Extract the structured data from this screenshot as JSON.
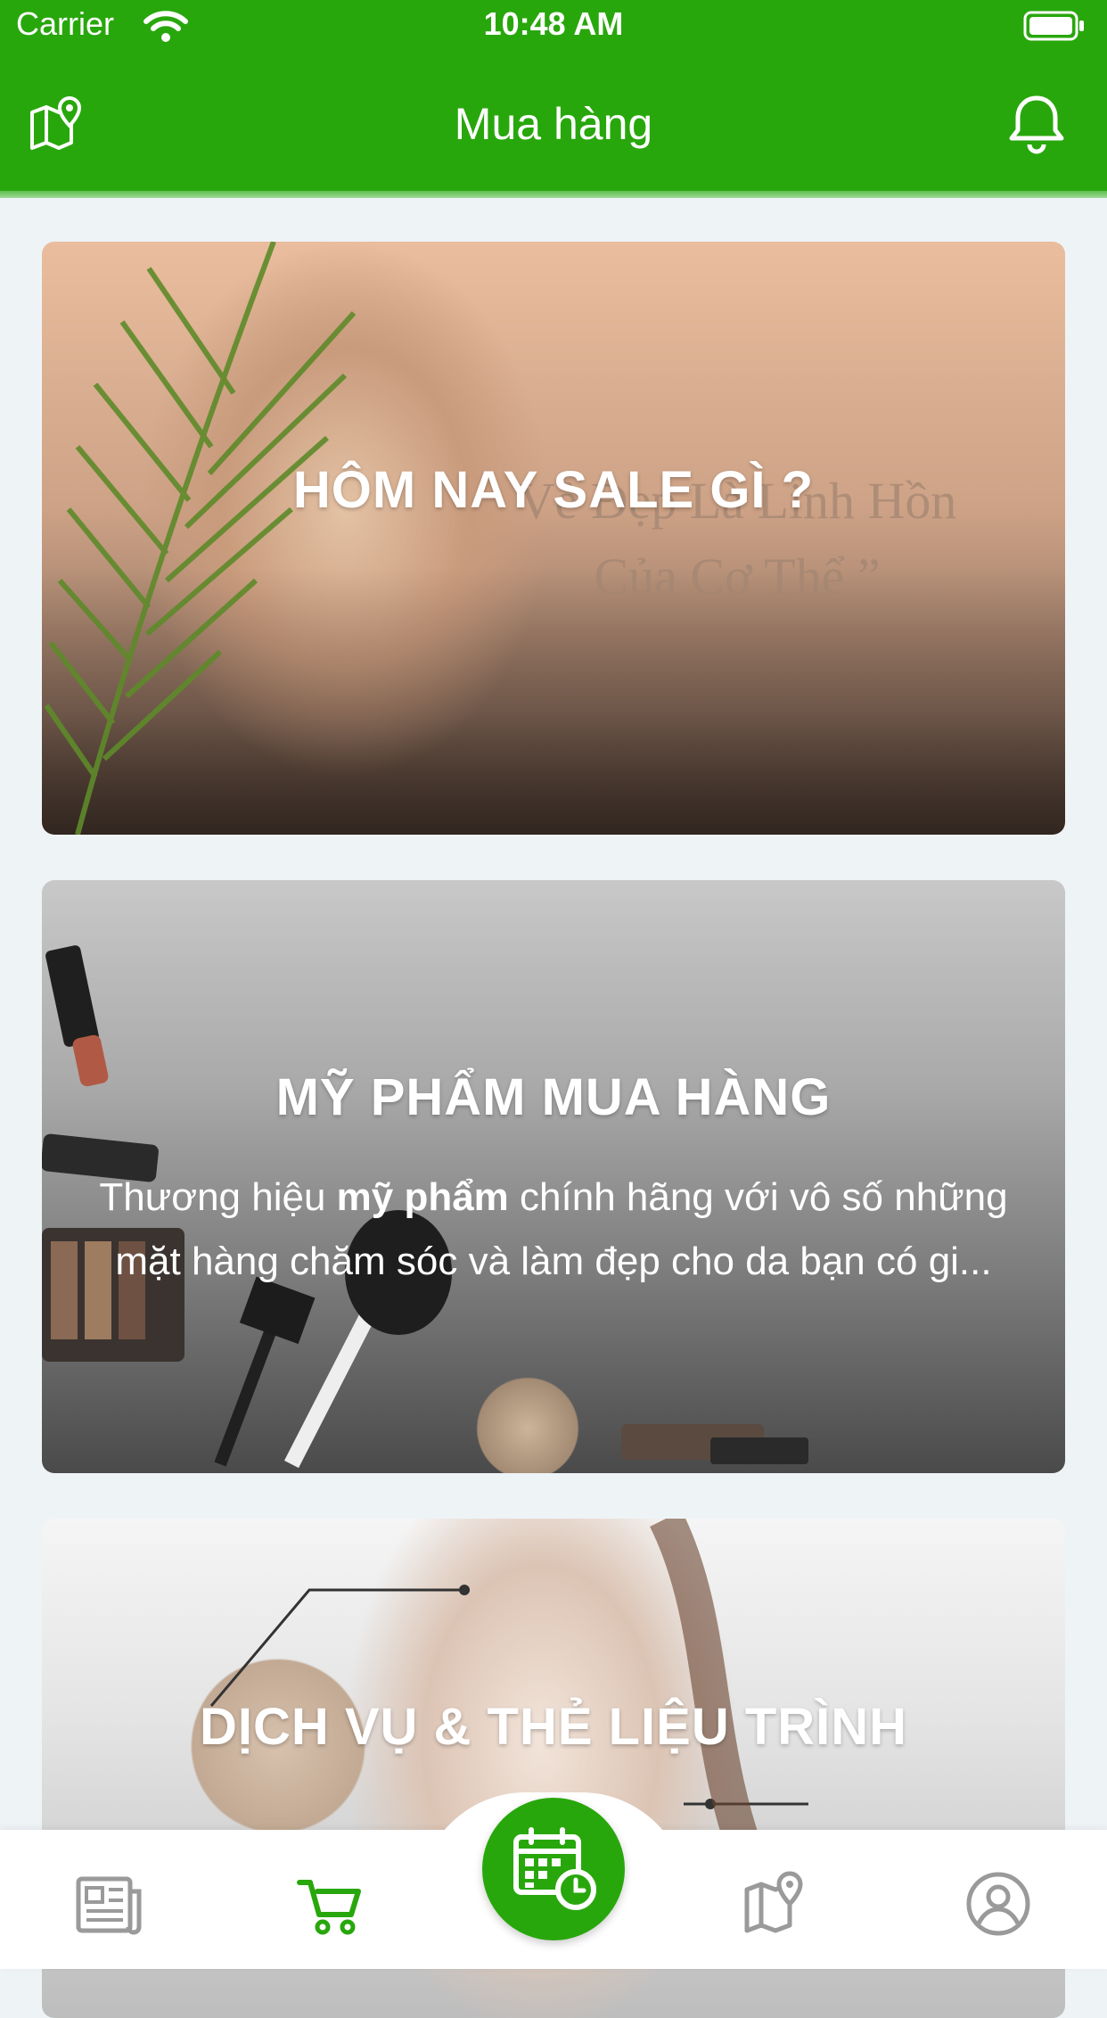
{
  "status_bar": {
    "carrier": "Carrier",
    "time": "10:48 AM"
  },
  "header": {
    "title": "Mua hàng",
    "left_icon": "map-pin-icon",
    "right_icon": "bell-icon"
  },
  "cards": [
    {
      "title": "HÔM NAY SALE GÌ ?",
      "image_text_line1": "Vẻ Đẹp Là Linh Hồn",
      "image_text_line2": "Của Cơ Thể ”"
    },
    {
      "title": "MỸ PHẨM MUA HÀNG",
      "desc_prefix": "Thương hiệu ",
      "desc_bold": "mỹ phẩm",
      "desc_suffix": " chính hãng với vô số những mặt hàng chăm sóc và làm đẹp cho da bạn có gi..."
    },
    {
      "title": "DỊCH VỤ & THẺ LIỆU TRÌNH"
    }
  ],
  "bottom_nav": {
    "items": [
      {
        "icon": "news-icon"
      },
      {
        "icon": "cart-icon",
        "active": true
      },
      {
        "icon": "calendar-clock-icon"
      },
      {
        "icon": "map-pin-icon"
      },
      {
        "icon": "user-icon"
      }
    ],
    "active_color": "#28a70c",
    "inactive_color": "#9a9a9a"
  },
  "colors": {
    "brand": "#28a70c",
    "background": "#eef3f6"
  }
}
